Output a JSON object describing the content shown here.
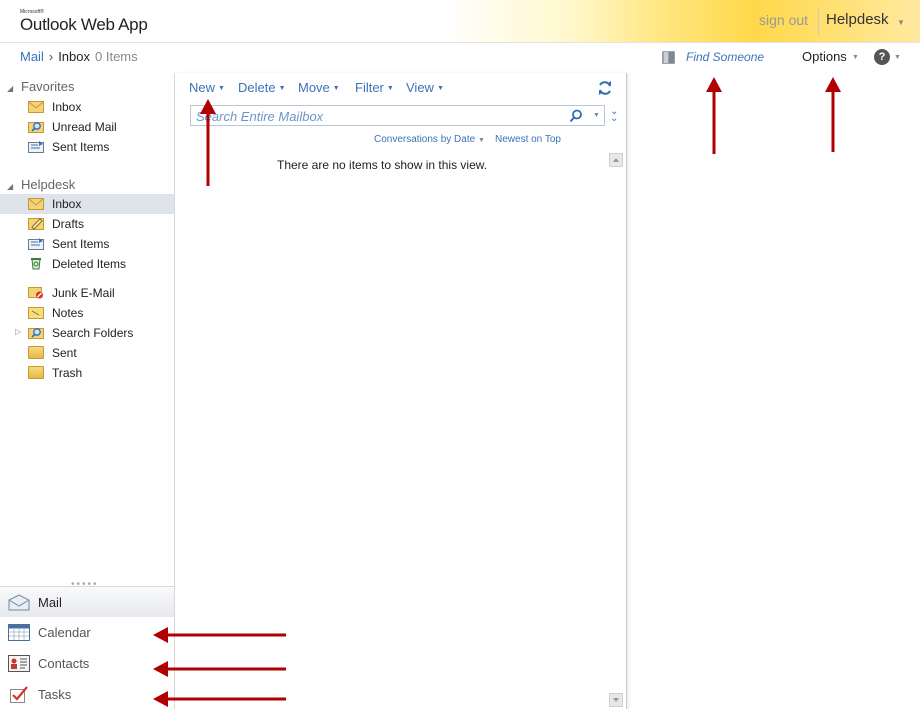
{
  "header": {
    "brand_small": "Microsoft®",
    "brand": "Outlook Web App",
    "sign_out": "sign out",
    "user": "Helpdesk"
  },
  "breadcrumb": {
    "root": "Mail",
    "folder": "Inbox",
    "count": "0 Items"
  },
  "topbar": {
    "find_someone": "Find Someone",
    "options": "Options",
    "help": "?"
  },
  "nav": {
    "favorites": {
      "title": "Favorites",
      "items": [
        {
          "label": "Inbox",
          "icon": "inbox-icon"
        },
        {
          "label": "Unread Mail",
          "icon": "search-folder-icon"
        },
        {
          "label": "Sent Items",
          "icon": "sent-items-icon"
        }
      ]
    },
    "mailbox": {
      "title": "Helpdesk",
      "items": [
        {
          "label": "Inbox",
          "icon": "inbox-icon",
          "selected": true
        },
        {
          "label": "Drafts",
          "icon": "drafts-icon"
        },
        {
          "label": "Sent Items",
          "icon": "sent-items-icon"
        },
        {
          "label": "Deleted Items",
          "icon": "deleted-items-icon"
        },
        {
          "label": "Junk E-Mail",
          "icon": "junk-icon"
        },
        {
          "label": "Notes",
          "icon": "notes-icon"
        },
        {
          "label": "Search Folders",
          "icon": "search-folder-icon"
        },
        {
          "label": "Sent",
          "icon": "folder-icon"
        },
        {
          "label": "Trash",
          "icon": "folder-icon"
        }
      ]
    },
    "modules": [
      {
        "label": "Mail",
        "icon": "mail-icon",
        "active": true
      },
      {
        "label": "Calendar",
        "icon": "calendar-icon"
      },
      {
        "label": "Contacts",
        "icon": "contacts-icon"
      },
      {
        "label": "Tasks",
        "icon": "tasks-icon"
      }
    ]
  },
  "toolbar": {
    "new": "New",
    "delete": "Delete",
    "move": "Move",
    "filter": "Filter",
    "view": "View"
  },
  "search": {
    "placeholder": "Search Entire Mailbox",
    "value": ""
  },
  "sort": {
    "by": "Conversations by Date",
    "order": "Newest on Top"
  },
  "list": {
    "empty_message": "There are no items to show in this view."
  },
  "colors": {
    "link": "#3b73b9",
    "arrow": "#b00000",
    "selected_bg": "#dfe4ea"
  }
}
